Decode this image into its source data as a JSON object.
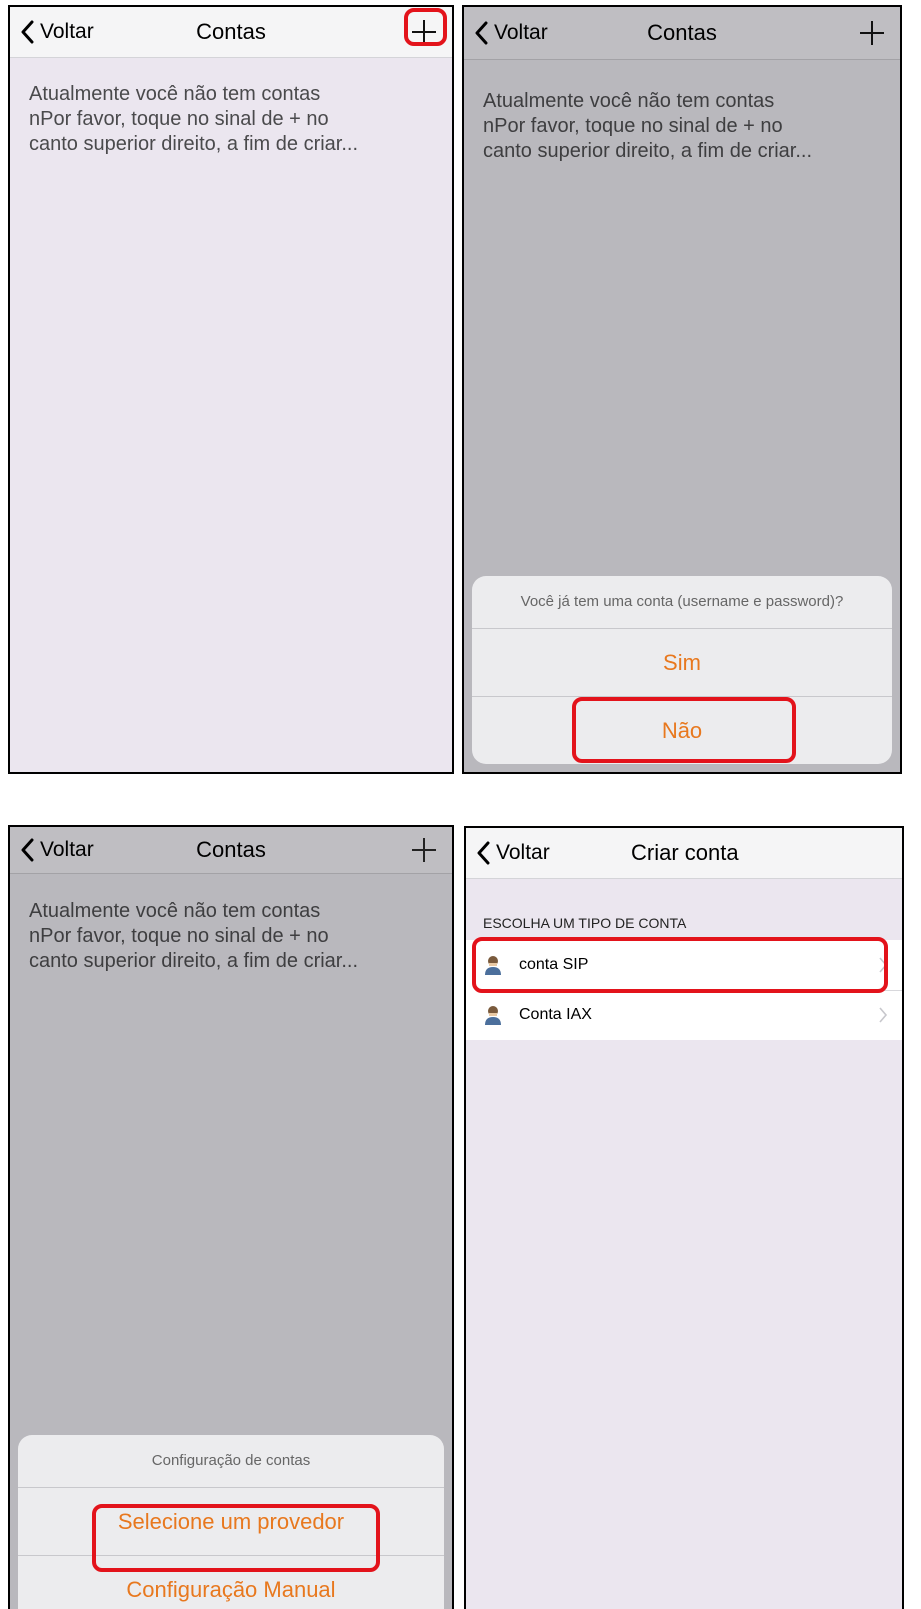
{
  "screen1": {
    "back_label": "Voltar",
    "title": "Contas",
    "message": "Atualmente você não tem contas\nnPor favor, toque no sinal de + no\ncanto superior direito, a fim de criar..."
  },
  "screen2": {
    "back_label": "Voltar",
    "title": "Contas",
    "message": "Atualmente você não tem contas\nnPor favor, toque no sinal de + no\ncanto superior direito, a fim de criar...",
    "sheet": {
      "title": "Você já tem uma conta (username e password)?",
      "options": [
        "Sim",
        "Não"
      ]
    }
  },
  "screen3": {
    "back_label": "Voltar",
    "title": "Contas",
    "message": "Atualmente você não tem contas\nnPor favor, toque no sinal de + no\ncanto superior direito, a fim de criar...",
    "sheet": {
      "title": "Configuração de contas",
      "options": [
        "Selecione um provedor",
        "Configuração Manual"
      ]
    }
  },
  "screen4": {
    "back_label": "Voltar",
    "title": "Criar conta",
    "section_header": "ESCOLHA UM TIPO DE CONTA",
    "rows": [
      "conta SIP",
      "Conta IAX"
    ]
  },
  "colors": {
    "accent": "#e8781e",
    "highlight": "#e3131b",
    "background_light": "#ebe6ef",
    "background_dimmed": "#b9b8bd"
  },
  "icons": [
    "chevron-left-icon",
    "plus-icon",
    "user-icon",
    "chevron-right-icon"
  ]
}
